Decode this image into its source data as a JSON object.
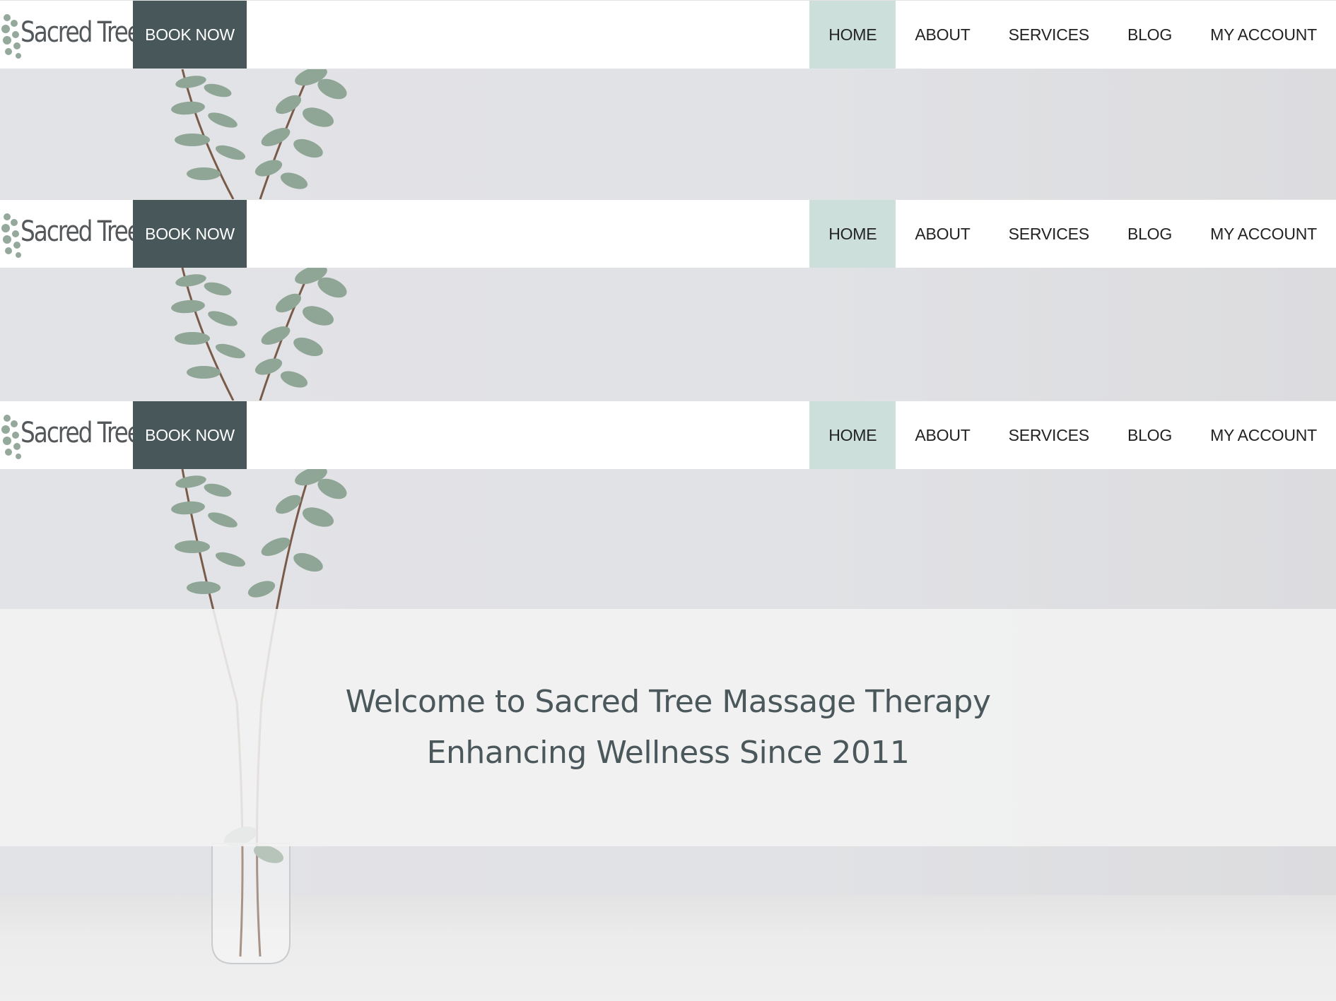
{
  "header": {
    "logo_text": "Sacred Tree",
    "book_label": "BOOK NOW",
    "nav": [
      {
        "label": "HOME",
        "active": true
      },
      {
        "label": "ABOUT",
        "active": false
      },
      {
        "label": "SERVICES",
        "active": false
      },
      {
        "label": "BLOG",
        "active": false
      },
      {
        "label": "MY ACCOUNT",
        "active": false
      }
    ]
  },
  "hero": {
    "line1": "Welcome to Sacred Tree Massage Therapy",
    "line2": "Enhancing Wellness Since 2011"
  },
  "colors": {
    "book_button": "#48575a",
    "active_nav": "#cddfda",
    "heading_text": "#4a575b"
  }
}
